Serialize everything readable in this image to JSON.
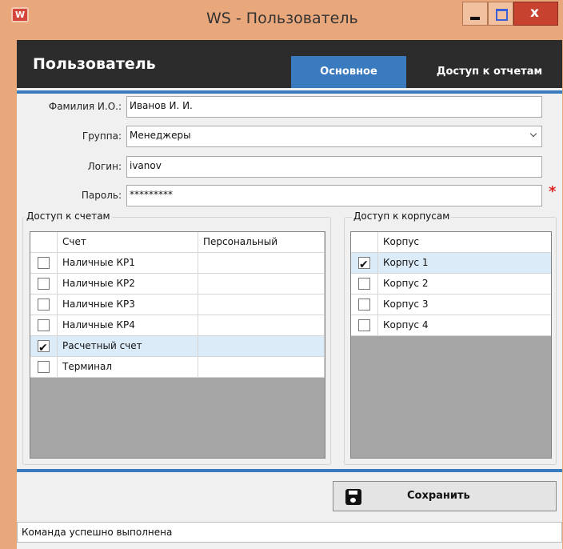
{
  "window": {
    "title": "WS - Пользователь",
    "close_glyph": "x",
    "app_icon_letter": "W",
    "accent_color": "#e9a77c"
  },
  "header": {
    "title": "Пользователь",
    "tabs": [
      {
        "label": "Основное",
        "active": true
      },
      {
        "label": "Доступ к отчетам",
        "active": false
      }
    ]
  },
  "form": {
    "fio_label": "Фамилия И.О.:",
    "fio_value": "Иванов И. И.",
    "group_label": "Группа:",
    "group_value": "Менеджеры",
    "login_label": "Логин:",
    "login_value": "ivanov",
    "password_label": "Пароль:",
    "password_value": "*********",
    "required_mark": "*"
  },
  "accounts": {
    "title": "Доступ к счетам",
    "col_account": "Счет",
    "col_personal": "Персональный",
    "rows": [
      {
        "name": "Наличные КР1",
        "checked": false,
        "personal": ""
      },
      {
        "name": "Наличные КР2",
        "checked": false,
        "personal": ""
      },
      {
        "name": "Наличные КР3",
        "checked": false,
        "personal": ""
      },
      {
        "name": "Наличные КР4",
        "checked": false,
        "personal": ""
      },
      {
        "name": "Расчетный счет",
        "checked": true,
        "personal": ""
      },
      {
        "name": "Терминал",
        "checked": false,
        "personal": ""
      }
    ]
  },
  "buildings": {
    "title": "Доступ к корпусам",
    "col_building": "Корпус",
    "rows": [
      {
        "name": "Корпус 1",
        "checked": true
      },
      {
        "name": "Корпус 2",
        "checked": false
      },
      {
        "name": "Корпус 3",
        "checked": false
      },
      {
        "name": "Корпус 4",
        "checked": false
      }
    ]
  },
  "actions": {
    "save_label": "Сохранить"
  },
  "status": {
    "text": "Команда успешно выполнена"
  },
  "icons": {
    "checkmark": "✔"
  }
}
